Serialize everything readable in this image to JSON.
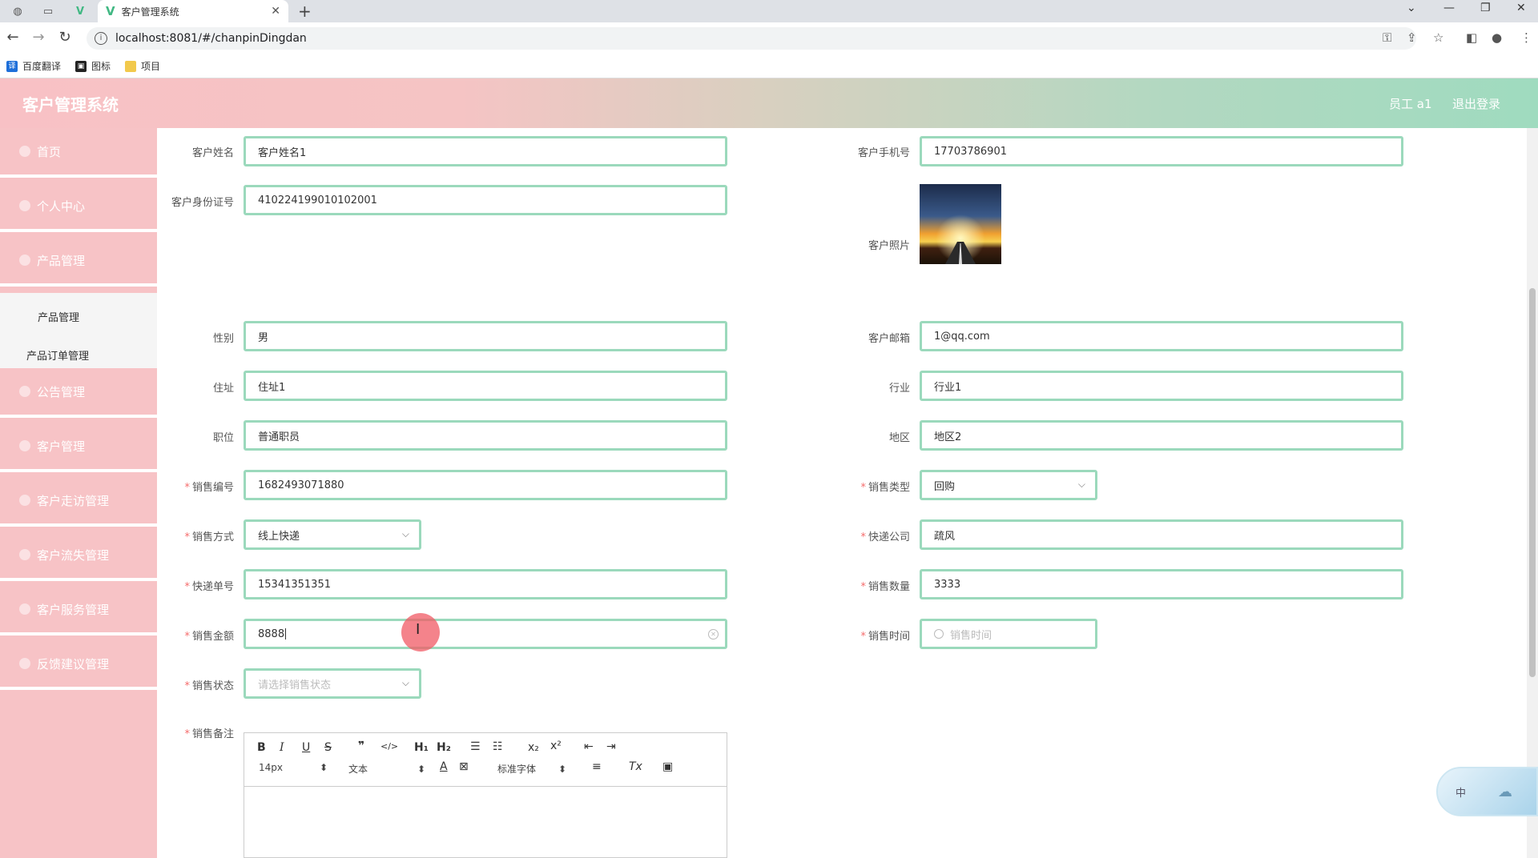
{
  "browser": {
    "tab_title": "客户管理系统",
    "url": "localhost:8081/#/chanpinDingdan",
    "bookmarks": [
      {
        "label": "百度翻译",
        "icon": "translate-icon",
        "color": "#1e6fd9"
      },
      {
        "label": "图标",
        "icon": "image-icon",
        "color": "#222"
      },
      {
        "label": "项目",
        "icon": "folder-icon",
        "color": "#f2c94c"
      }
    ]
  },
  "header": {
    "title": "客户管理系统",
    "user": "员工 a1",
    "logout": "退出登录"
  },
  "sidebar": {
    "items": [
      {
        "label": "首页"
      },
      {
        "label": "个人中心"
      },
      {
        "label": "产品管理"
      },
      {
        "label": "公告管理"
      },
      {
        "label": "客户管理"
      },
      {
        "label": "客户走访管理"
      },
      {
        "label": "客户流失管理"
      },
      {
        "label": "客户服务管理"
      },
      {
        "label": "反馈建议管理"
      }
    ],
    "submenu": [
      {
        "label": "产品管理"
      },
      {
        "label": "产品订单管理"
      }
    ]
  },
  "form": {
    "customer_name": {
      "label": "客户姓名",
      "value": "客户姓名1"
    },
    "customer_phone": {
      "label": "客户手机号",
      "value": "17703786901"
    },
    "customer_id": {
      "label": "客户身份证号",
      "value": "410224199010102001"
    },
    "customer_photo": {
      "label": "客户照片"
    },
    "gender": {
      "label": "性别",
      "value": "男"
    },
    "email": {
      "label": "客户邮箱",
      "value": "1@qq.com"
    },
    "address": {
      "label": "住址",
      "value": "住址1"
    },
    "industry": {
      "label": "行业",
      "value": "行业1"
    },
    "position": {
      "label": "职位",
      "value": "普通职员"
    },
    "region": {
      "label": "地区",
      "value": "地区2"
    },
    "sale_no": {
      "label": "销售编号",
      "value": "1682493071880"
    },
    "sale_type": {
      "label": "销售类型",
      "value": "回购"
    },
    "sale_method": {
      "label": "销售方式",
      "value": "线上快递"
    },
    "express_company": {
      "label": "快递公司",
      "value": "疏风"
    },
    "tracking_no": {
      "label": "快递单号",
      "value": "15341351351"
    },
    "sale_qty": {
      "label": "销售数量",
      "value": "3333"
    },
    "sale_amount": {
      "label": "销售金额",
      "value": "8888"
    },
    "sale_time": {
      "label": "销售时间",
      "placeholder": "销售时间"
    },
    "sale_status": {
      "label": "销售状态",
      "placeholder": "请选择销售状态"
    },
    "sale_note": {
      "label": "销售备注"
    }
  },
  "editor": {
    "font_size": "14px",
    "block_type": "文本",
    "font_family": "标准字体"
  },
  "widget": {
    "label": "中"
  }
}
